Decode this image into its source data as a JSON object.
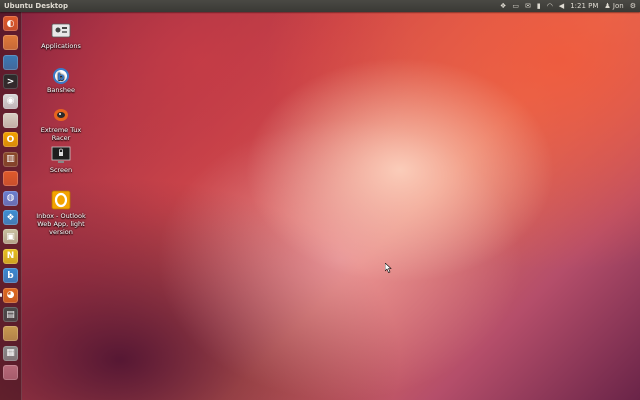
{
  "window": {
    "title": "Ubuntu Desktop"
  },
  "top_panel": {
    "tray": [
      {
        "name": "dropbox-icon",
        "glyph": "❖"
      },
      {
        "name": "printer-icon",
        "glyph": "▭"
      },
      {
        "name": "mail-icon",
        "glyph": "✉"
      },
      {
        "name": "battery-icon",
        "glyph": "▮"
      },
      {
        "name": "network-icon",
        "glyph": "◠"
      },
      {
        "name": "volume-icon",
        "glyph": "◀"
      }
    ],
    "clock": "1:21 PM",
    "user": "Jon",
    "gear_glyph": "⚙"
  },
  "launcher": {
    "items": [
      {
        "name": "launcher-dash-icon",
        "color": "#e05a2b",
        "glyph": "◐",
        "active": false
      },
      {
        "name": "launcher-files-icon",
        "color": "#e07a3a",
        "glyph": "",
        "active": false
      },
      {
        "name": "launcher-writer-icon",
        "color": "#3b7ab5",
        "glyph": "",
        "active": false
      },
      {
        "name": "launcher-terminal-icon",
        "color": "#2b2b2b",
        "glyph": ">",
        "active": false
      },
      {
        "name": "launcher-chrome-icon",
        "color": "#d8d8d8",
        "glyph": "◉",
        "active": false
      },
      {
        "name": "launcher-software-center-icon",
        "color": "#d9d0c4",
        "glyph": "",
        "active": false
      },
      {
        "name": "launcher-outlook-icon",
        "color": "#f4a300",
        "glyph": "O",
        "active": false
      },
      {
        "name": "launcher-books-icon",
        "color": "#8a4a2a",
        "glyph": "▥",
        "active": false
      },
      {
        "name": "launcher-update-icon",
        "color": "#e05a2b",
        "glyph": "",
        "active": false
      },
      {
        "name": "launcher-network-icon",
        "color": "#6a7fd0",
        "glyph": "◍",
        "active": false
      },
      {
        "name": "launcher-dropbox-icon",
        "color": "#3d8fd4",
        "glyph": "❖",
        "active": false
      },
      {
        "name": "launcher-app-icon",
        "color": "#c8c0a0",
        "glyph": "▣",
        "active": false
      },
      {
        "name": "launcher-n-icon",
        "color": "#e8c020",
        "glyph": "N",
        "active": false
      },
      {
        "name": "launcher-banshee-icon",
        "color": "#3a8ad4",
        "glyph": "b",
        "active": false
      },
      {
        "name": "launcher-firefox-icon",
        "color": "#e06a20",
        "glyph": "◕",
        "active": true
      },
      {
        "name": "launcher-system-monitor-icon",
        "color": "#4a4a4a",
        "glyph": "▤",
        "active": false
      },
      {
        "name": "launcher-archive-icon",
        "color": "#c89a50",
        "glyph": "",
        "active": false
      },
      {
        "name": "launcher-workspaces-icon",
        "color": "#8a8a8a",
        "glyph": "▦",
        "active": false
      },
      {
        "name": "launcher-trash-icon",
        "color": "#b86a7a",
        "glyph": "",
        "active": false
      }
    ]
  },
  "desktop": {
    "icons": [
      {
        "name": "applications-icon",
        "label": "Applications"
      },
      {
        "name": "banshee-icon",
        "label": "Banshee"
      },
      {
        "name": "extreme-tux-racer-icon",
        "label": "Extreme Tux Racer"
      },
      {
        "name": "screen-icon",
        "label": "Screen"
      },
      {
        "name": "outlook-web-app-icon",
        "label": "Inbox - Outlook Web App, light version"
      }
    ]
  }
}
